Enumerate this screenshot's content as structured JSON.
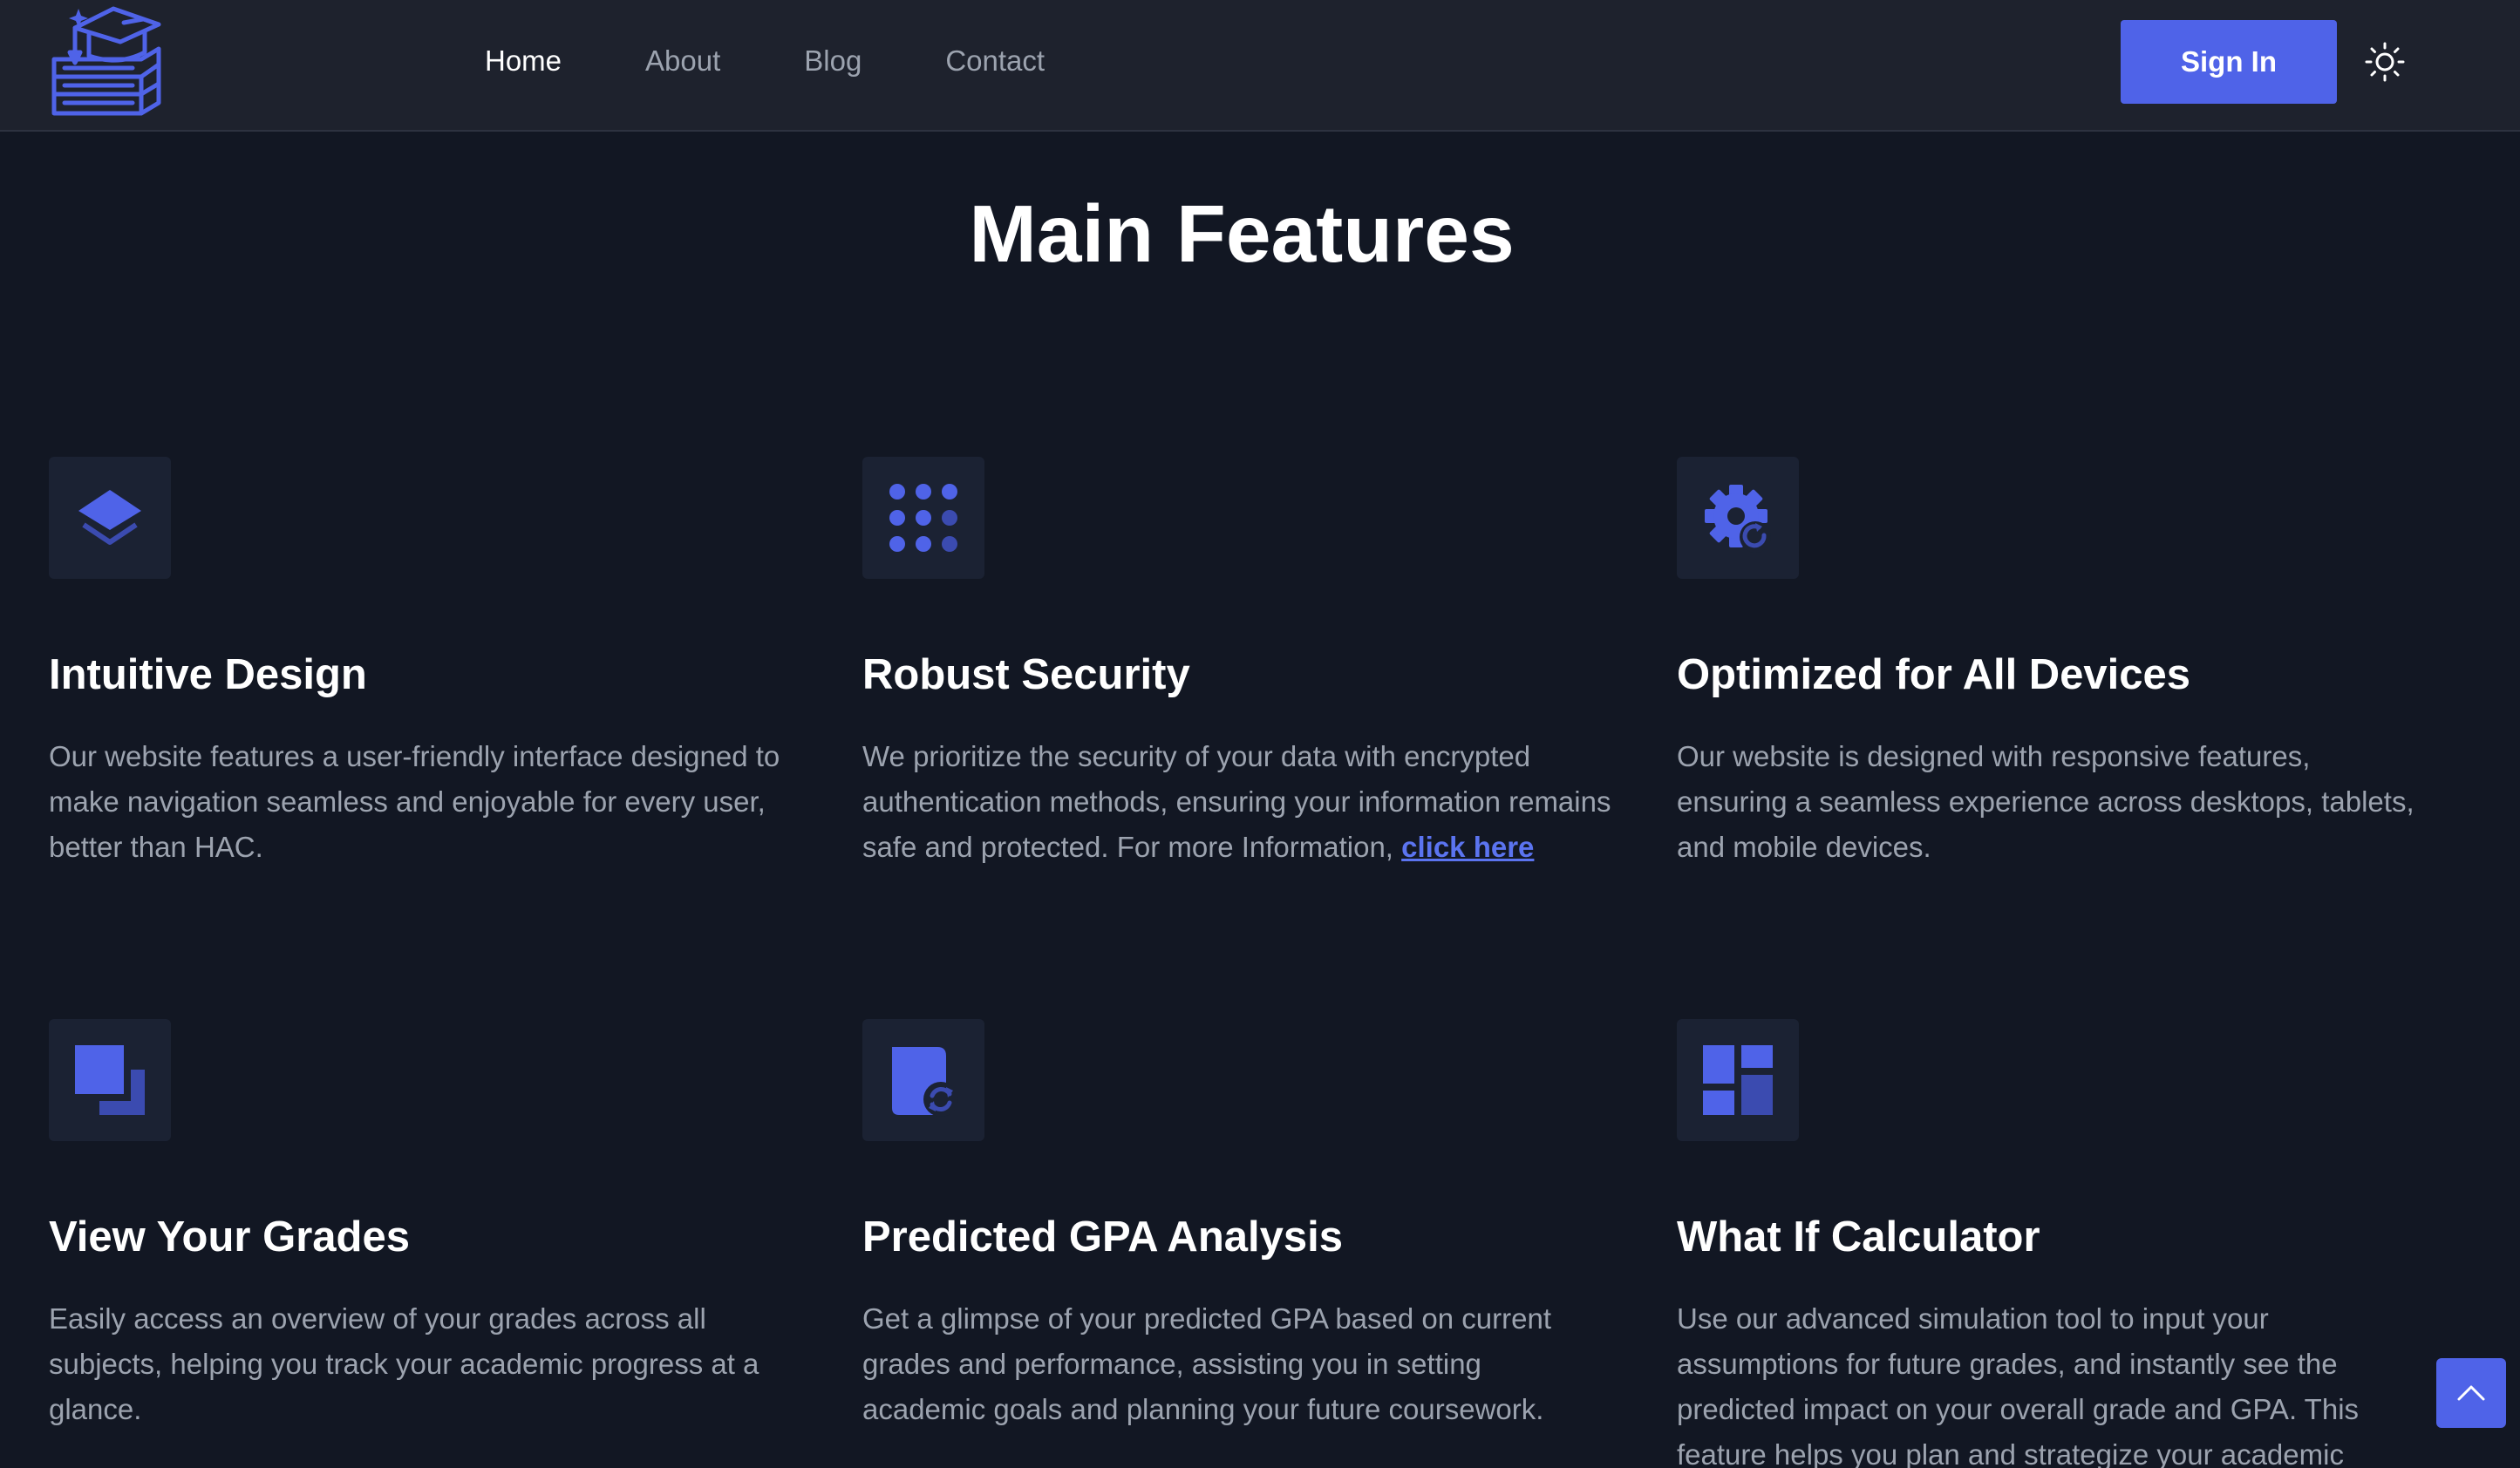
{
  "header": {
    "nav": [
      "Home",
      "About",
      "Blog",
      "Contact"
    ],
    "signin_label": "Sign In"
  },
  "main": {
    "title": "Main Features",
    "features": [
      {
        "title": "Intuitive Design",
        "description": "Our website features a user-friendly interface designed to make navigation seamless and enjoyable for every user, better than HAC.",
        "icon": "layers-icon"
      },
      {
        "title": "Robust Security",
        "description": "We prioritize the security of your data with encrypted authentication methods, ensuring your information remains safe and protected. For more Information, ",
        "link_text": "click here",
        "icon": "grid-dots-icon"
      },
      {
        "title": "Optimized for All Devices",
        "description": "Our website is designed with responsive features, ensuring a seamless experience across desktops, tablets, and mobile devices.",
        "icon": "gear-refresh-icon"
      },
      {
        "title": "View Your Grades",
        "description": "Easily access an overview of your grades across all subjects, helping you track your academic progress at a glance.",
        "icon": "stacked-squares-icon"
      },
      {
        "title": "Predicted GPA Analysis",
        "description": "Get a glimpse of your predicted GPA based on current grades and performance, assisting you in setting academic goals and planning your future coursework.",
        "icon": "document-sync-icon"
      },
      {
        "title": "What If Calculator",
        "description": "Use our advanced simulation tool to input your assumptions for future grades, and instantly see the predicted impact on your overall grade and GPA. This feature helps you plan and strategize your academic",
        "icon": "dashboard-icon"
      }
    ]
  },
  "colors": {
    "background": "#121723",
    "header_bg": "#1e222d",
    "accent": "#4f63e8",
    "link": "#5b74f0",
    "body_text": "#9ca3af",
    "icon_box": "#1b2233"
  }
}
